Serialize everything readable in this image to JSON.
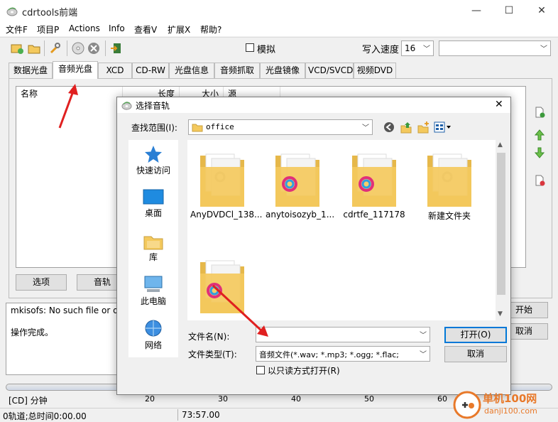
{
  "window": {
    "title": "cdrtools前端",
    "minimize": "—",
    "maximize": "☐",
    "close": "✕"
  },
  "menu": [
    "文件F",
    "项目P",
    "Actions",
    "Info",
    "查看V",
    "扩展X",
    "帮助?"
  ],
  "toolbar": {
    "simulate_label": "模拟",
    "write_speed_label": "写入速度",
    "write_speed_value": "16",
    "drive_value": ""
  },
  "tabs": [
    "数据光盘",
    "音频光盘",
    "XCD",
    "CD-RW",
    "光盘信息",
    "音频抓取",
    "光盘镜像",
    "VCD/SVCD",
    "视频DVD"
  ],
  "active_tab": 1,
  "list": {
    "columns": [
      "名称",
      "长度",
      "大小",
      "源"
    ]
  },
  "buttons": {
    "options": "选项",
    "tracks": "音轨",
    "start": "开始",
    "cancel": "取消"
  },
  "log": {
    "line1": "mkisofs: No such file or direc",
    "line2": "操作完成。"
  },
  "scale": {
    "unit": "[CD] 分钟",
    "ticks": [
      "20",
      "30",
      "40",
      "50",
      "60"
    ]
  },
  "status": {
    "tracks": "0轨道;总时间0:00.00",
    "capacity": "73:57.00"
  },
  "dialog": {
    "title": "选择音轨",
    "close": "✕",
    "look_in_label": "查找范围(I):",
    "look_in_value": "office",
    "places": [
      "快速访问",
      "桌面",
      "库",
      "此电脑",
      "网络"
    ],
    "files": [
      "AnyDVDCl_138...",
      "anytoisozyb_1...",
      "cdrtfe_117178",
      "新建文件夹",
      ""
    ],
    "filename_label": "文件名(N):",
    "filename_value": "",
    "filetype_label": "文件类型(T):",
    "filetype_value": "音频文件(*.wav; *.mp3; *.ogg; *.flac;",
    "open_button": "打开(O)",
    "cancel_button": "取消",
    "readonly_label": "以只读方式打开(R)"
  },
  "watermark": {
    "text": "单机100网",
    "url": "danji100.com"
  },
  "colors": {
    "accent": "#0078d7",
    "annotation_arrow": "#e02020",
    "folder": "#f4c95d"
  }
}
